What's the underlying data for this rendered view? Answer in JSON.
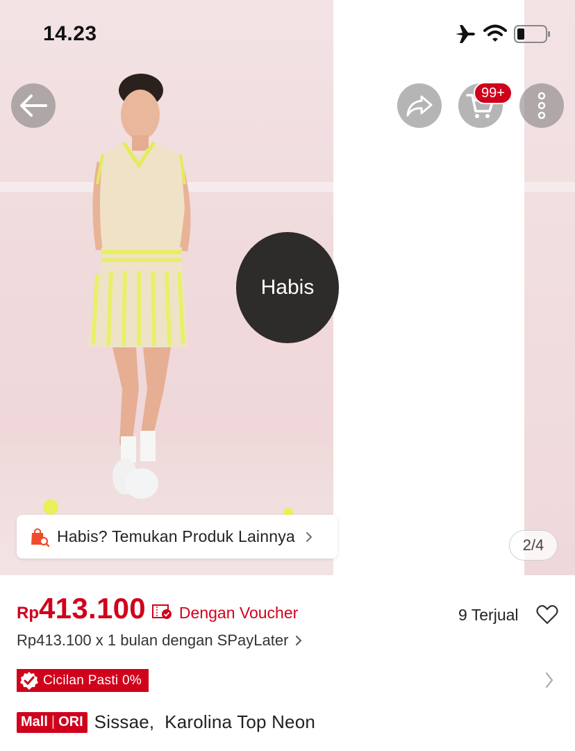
{
  "status_bar": {
    "time": "14.23",
    "icons": [
      "airplane-icon",
      "wifi-icon",
      "battery-icon"
    ]
  },
  "header": {
    "back_icon": "arrow-left-icon",
    "share_icon": "share-icon",
    "cart_icon": "cart-icon",
    "cart_badge": "99+",
    "more_icon": "more-vertical-icon"
  },
  "gallery": {
    "soldout_label": "Habis",
    "find_others_label": "Habis? Temukan Produk Lainnya",
    "find_others_icon": "shopping-bag-search-icon",
    "counter": "2/4"
  },
  "price": {
    "currency": "Rp",
    "amount": "413.100",
    "voucher_icon": "voucher-check-icon",
    "voucher_label": "Dengan Voucher",
    "sold": "9 Terjual",
    "paylater": "Rp413.100 x 1 bulan dengan SPayLater"
  },
  "installment": {
    "label": "Cicilan Pasti 0%"
  },
  "product": {
    "mall_label": "Mall",
    "ori_label": "ORI",
    "title": "Sissae,  Karolina Top Neon"
  },
  "colors": {
    "accent": "#d0011b",
    "bubble": "#2e2b2b",
    "background_pink": "#f0dadc"
  }
}
